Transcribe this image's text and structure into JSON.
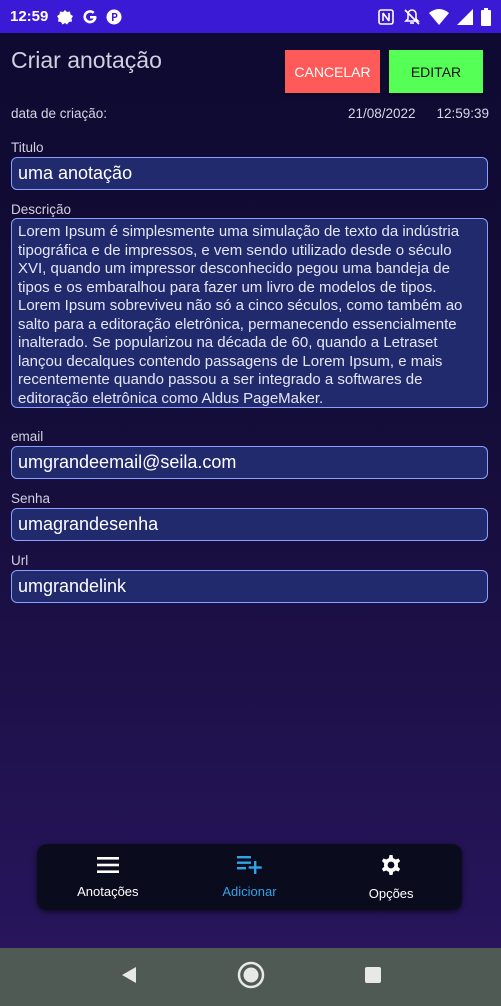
{
  "status_bar": {
    "time": "12:59",
    "left_icons": [
      "gear-notification-icon",
      "google-icon",
      "p-app-icon"
    ],
    "right_icons": [
      "nfc-icon",
      "mute-icon",
      "wifi-icon",
      "signal-icon",
      "battery-icon"
    ]
  },
  "header": {
    "title": "Criar anotação",
    "cancel_label": "CANCELAR",
    "edit_label": "EDITAR"
  },
  "meta": {
    "created_label": "data de criação:",
    "created_date": "21/08/2022",
    "created_time": "12:59:39"
  },
  "form": {
    "title_label": "Titulo",
    "title_value": "uma anotação",
    "description_label": "Descrição",
    "description_value": "Lorem Ipsum é simplesmente uma simulação de texto da indústria tipográfica e de impressos, e vem sendo utilizado desde o século XVI, quando um impressor desconhecido pegou uma bandeja de tipos e os embaralhou para fazer um livro de modelos de tipos. Lorem Ipsum sobreviveu não só a cinco séculos, como também ao salto para a editoração eletrônica, permanecendo essencialmente inalterado. Se popularizou na década de 60, quando a Letraset lançou decalques contendo passagens de Lorem Ipsum, e mais recentemente quando passou a ser integrado a softwares de editoração eletrônica como Aldus PageMaker.",
    "email_label": "email",
    "email_value": "umgrandeemail@seila.com",
    "password_label": "Senha",
    "password_value": "umagrandesenha",
    "url_label": "Url",
    "url_value": "umgrandelink"
  },
  "bottom_nav": {
    "items": [
      {
        "label": "Anotações",
        "icon": "menu-icon"
      },
      {
        "label": "Adicionar",
        "icon": "playlist-add-icon",
        "active": true
      },
      {
        "label": "Opções",
        "icon": "gear-icon"
      }
    ]
  },
  "colors": {
    "status_bar": "#3b1ad6",
    "cancel": "#ff5a5a",
    "edit": "#55ff55",
    "input_bg": "#222a6e",
    "input_border": "#8aa0ff",
    "active_nav": "#2fa3e6"
  }
}
